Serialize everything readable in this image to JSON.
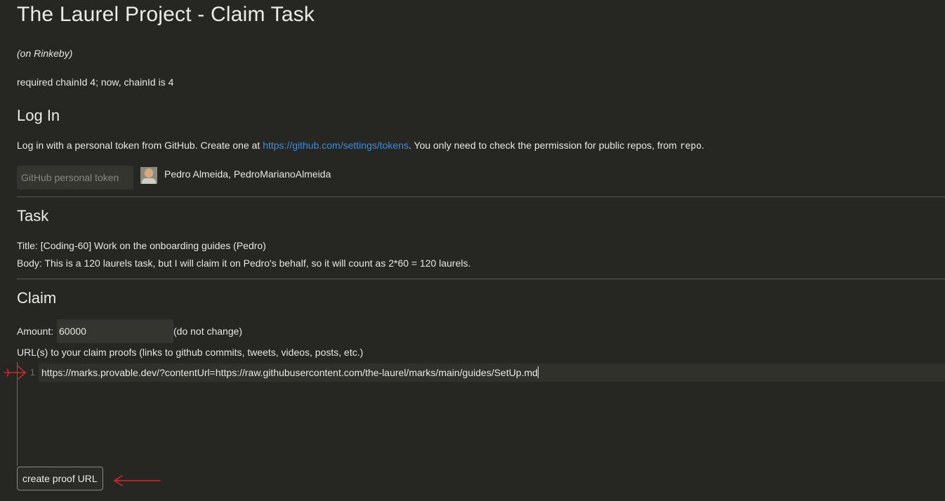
{
  "page": {
    "title": "The Laurel Project - Claim Task",
    "network_note": "(on Rinkeby)",
    "chain_status": "required chainId 4; now, chainId is 4"
  },
  "login": {
    "heading": "Log In",
    "desc_before": "Log in with a personal token from GitHub. Create one at ",
    "link_text": "https://github.com/settings/tokens",
    "desc_after": ". You only need to check the permission for public repos, from ",
    "code_text": "repo",
    "desc_end": ".",
    "token_placeholder": "GitHub personal token",
    "token_value": "",
    "user_name": "Pedro Almeida, PedroMarianoAlmeida"
  },
  "task": {
    "heading": "Task",
    "title_line": "Title: [Coding-60] Work on the onboarding guides (Pedro)",
    "body_line": "Body: This is a 120 laurels task, but I will claim it on Pedro's behalf, so it will count as 2*60 = 120 laurels."
  },
  "claim": {
    "heading": "Claim",
    "amount_label": "Amount:",
    "amount_value": "60000",
    "amount_note": "(do not change)",
    "proof_label": "URL(s) to your claim proofs (links to github commits, tweets, videos, posts, etc.)",
    "editor_lines": [
      {
        "number": "1",
        "text": "https://marks.provable.dev/?contentUrl=https://raw.githubusercontent.com/the-laurel/marks/main/guides/SetUp.md"
      }
    ],
    "create_button": "create proof URL"
  },
  "colors": {
    "background": "#262622",
    "link": "#3b8de0",
    "annotation_arrow": "#d42a2a"
  },
  "icons": {
    "avatar": "user-avatar-photo",
    "annotations": [
      "red-arrow-annotation-icon"
    ]
  }
}
